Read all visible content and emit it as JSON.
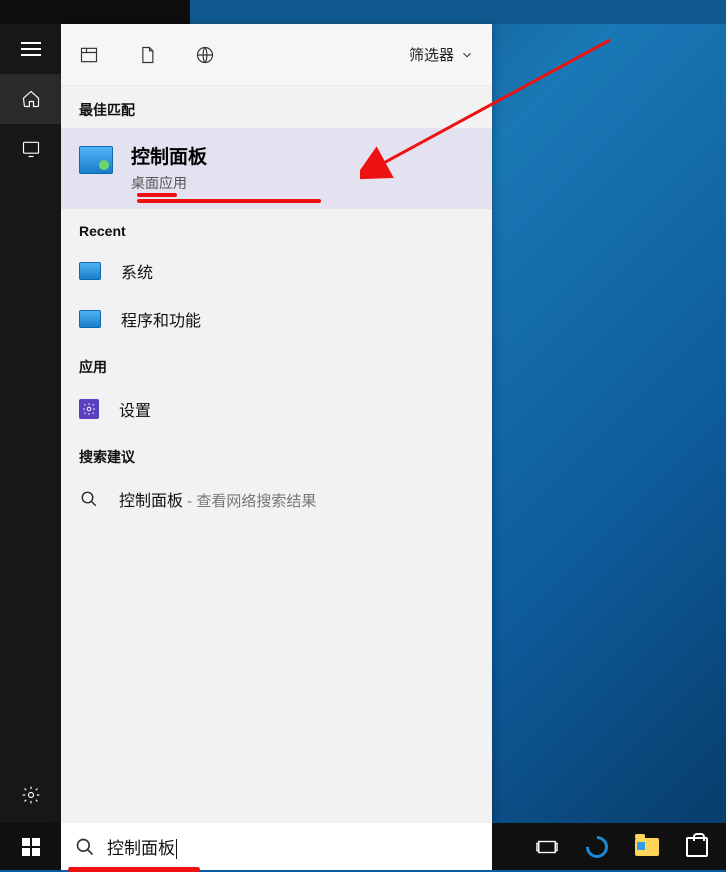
{
  "filter_label": "筛选器",
  "sections": {
    "best_match": "最佳匹配",
    "recent": "Recent",
    "apps": "应用",
    "suggestions": "搜索建议"
  },
  "best": {
    "title": "控制面板",
    "subtitle": "桌面应用"
  },
  "recent_items": [
    "系统",
    "程序和功能"
  ],
  "app_items": [
    "设置"
  ],
  "suggestion": {
    "term": "控制面板",
    "hint": " - 查看网络搜索结果"
  },
  "search_query": "控制面板",
  "rail": {
    "menu": "menu",
    "home": "home",
    "screen": "screen",
    "settings": "settings",
    "user": "user"
  }
}
